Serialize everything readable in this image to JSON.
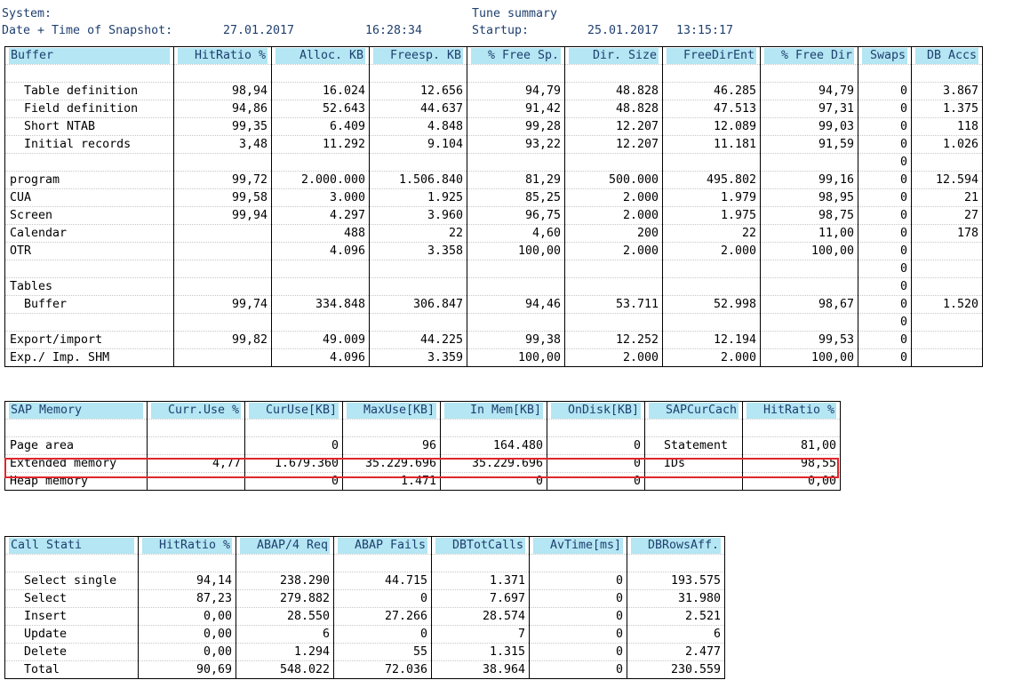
{
  "header": {
    "system_label": "System:",
    "snapshot_label": "Date + Time of Snapshot:",
    "snapshot_date": "27.01.2017",
    "snapshot_time": "16:28:34",
    "tune_summary": "Tune summary",
    "startup_label": "Startup:",
    "startup_date": "25.01.2017",
    "startup_time": "13:15:17"
  },
  "buffer_table": {
    "headers": [
      "Buffer",
      "HitRatio %",
      "Alloc. KB",
      "Freesp. KB",
      "% Free Sp.",
      "Dir. Size",
      "FreeDirEnt",
      "% Free Dir",
      "Swaps",
      "DB Accs"
    ],
    "rows": [
      [
        "",
        "",
        "",
        "",
        "",
        "",
        "",
        "",
        "",
        ""
      ],
      [
        "  Table definition",
        "98,94",
        "16.024",
        "12.656",
        "94,79",
        "48.828",
        "46.285",
        "94,79",
        "0",
        "3.867"
      ],
      [
        "  Field definition",
        "94,86",
        "52.643",
        "44.637",
        "91,42",
        "48.828",
        "47.513",
        "97,31",
        "0",
        "1.375"
      ],
      [
        "  Short NTAB",
        "99,35",
        "6.409",
        "4.848",
        "99,28",
        "12.207",
        "12.089",
        "99,03",
        "0",
        "118"
      ],
      [
        "  Initial records",
        "3,48",
        "11.292",
        "9.104",
        "93,22",
        "12.207",
        "11.181",
        "91,59",
        "0",
        "1.026"
      ],
      [
        "",
        "",
        "",
        "",
        "",
        "",
        "",
        "",
        "0",
        ""
      ],
      [
        "program",
        "99,72",
        "2.000.000",
        "1.506.840",
        "81,29",
        "500.000",
        "495.802",
        "99,16",
        "0",
        "12.594"
      ],
      [
        "CUA",
        "99,58",
        "3.000",
        "1.925",
        "85,25",
        "2.000",
        "1.979",
        "98,95",
        "0",
        "21"
      ],
      [
        "Screen",
        "99,94",
        "4.297",
        "3.960",
        "96,75",
        "2.000",
        "1.975",
        "98,75",
        "0",
        "27"
      ],
      [
        "Calendar",
        "",
        "488",
        "22",
        "4,60",
        "200",
        "22",
        "11,00",
        "0",
        "178"
      ],
      [
        "OTR",
        "",
        "4.096",
        "3.358",
        "100,00",
        "2.000",
        "2.000",
        "100,00",
        "0",
        ""
      ],
      [
        "",
        "",
        "",
        "",
        "",
        "",
        "",
        "",
        "0",
        ""
      ],
      [
        "Tables",
        "",
        "",
        "",
        "",
        "",
        "",
        "",
        "0",
        ""
      ],
      [
        "  Buffer",
        "99,74",
        "334.848",
        "306.847",
        "94,46",
        "53.711",
        "52.998",
        "98,67",
        "0",
        "1.520"
      ],
      [
        "",
        "",
        "",
        "",
        "",
        "",
        "",
        "",
        "0",
        ""
      ],
      [
        "Export/import",
        "99,82",
        "49.009",
        "44.225",
        "99,38",
        "12.252",
        "12.194",
        "99,53",
        "0",
        ""
      ],
      [
        "Exp./ Imp. SHM",
        "",
        "4.096",
        "3.359",
        "100,00",
        "2.000",
        "2.000",
        "100,00",
        "0",
        ""
      ]
    ]
  },
  "sap_memory_table": {
    "headers": [
      "SAP Memory",
      "Curr.Use %",
      "CurUse[KB]",
      "MaxUse[KB]",
      "In Mem[KB]",
      "OnDisk[KB]",
      "SAPCurCach",
      "HitRatio %"
    ],
    "rows": [
      [
        "",
        "",
        "",
        "",
        "",
        "",
        "",
        ""
      ],
      [
        "Page area",
        "",
        "0",
        "96",
        "164.480",
        "0",
        "  Statement",
        "81,00"
      ],
      [
        "Extended memory",
        "4,77",
        "1.679.360",
        "35.229.696",
        "35.229.696",
        "0",
        "  IDs",
        "98,55"
      ],
      [
        "Heap memory",
        "",
        "0",
        "1.471",
        "0",
        "0",
        "",
        "0,00"
      ]
    ]
  },
  "call_stats_table": {
    "headers": [
      "Call Stati",
      "HitRatio %",
      "ABAP/4 Req",
      "ABAP Fails",
      "DBTotCalls",
      "AvTime[ms]",
      "DBRowsAff."
    ],
    "rows": [
      [
        "",
        "",
        "",
        "",
        "",
        "",
        ""
      ],
      [
        "  Select single",
        "94,14",
        "238.290",
        "44.715",
        "1.371",
        "0",
        "193.575"
      ],
      [
        "  Select",
        "87,23",
        "279.882",
        "0",
        "7.697",
        "0",
        "31.980"
      ],
      [
        "  Insert",
        "0,00",
        "28.550",
        "27.266",
        "28.574",
        "0",
        "2.521"
      ],
      [
        "  Update",
        "0,00",
        "6",
        "0",
        "7",
        "0",
        "6"
      ],
      [
        "  Delete",
        "0,00",
        "1.294",
        "55",
        "1.315",
        "0",
        "2.477"
      ],
      [
        "  Total",
        "90,69",
        "548.022",
        "72.036",
        "38.964",
        "0",
        "230.559"
      ]
    ]
  },
  "colors": {
    "header_bg": "#b4e6f3",
    "header_text": "#1f3f6f",
    "highlight_border": "#e0262b"
  }
}
